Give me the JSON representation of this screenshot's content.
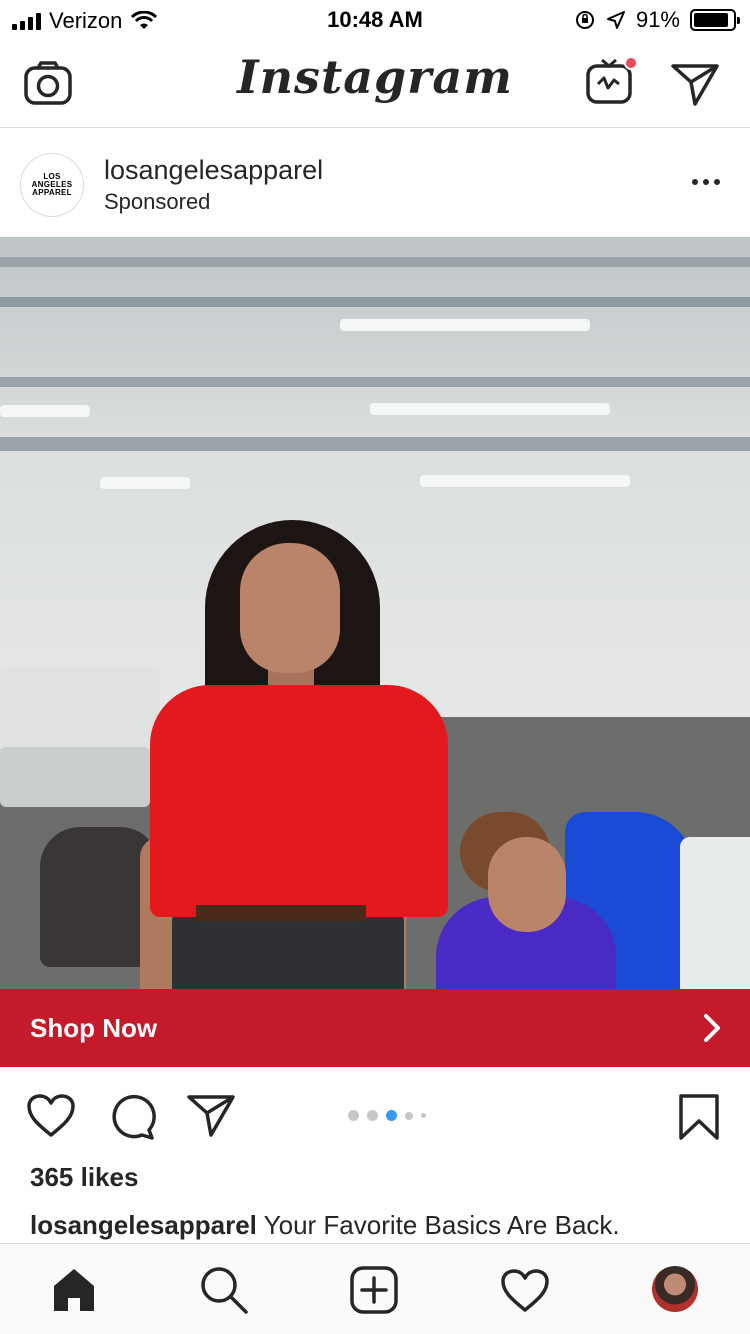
{
  "status_bar": {
    "carrier": "Verizon",
    "time": "10:48 AM",
    "battery": "91%",
    "battery_level": 0.91
  },
  "header": {
    "logo": "Instagram",
    "icons": [
      "camera-icon",
      "igtv-icon",
      "direct-message-icon"
    ],
    "notification_color": "#ed4956"
  },
  "post": {
    "username": "losangelesapparel",
    "subtitle": "Sponsored",
    "avatar_logo_lines": [
      "LOS",
      "ANGELES",
      "APPAREL"
    ],
    "cta_label": "Shop Now",
    "cta_color": "#c41a2a",
    "carousel_dots": 5,
    "carousel_active_index": 2,
    "likes": "365 likes",
    "caption_user": "losangelesapparel",
    "caption_text": "Your Favorite Basics Are Back."
  },
  "tab_bar": {
    "items": [
      "home-icon",
      "search-icon",
      "new-post-icon",
      "activity-icon",
      "profile-avatar"
    ]
  },
  "colors": {
    "accent": "#3897f0",
    "text": "#262626"
  }
}
